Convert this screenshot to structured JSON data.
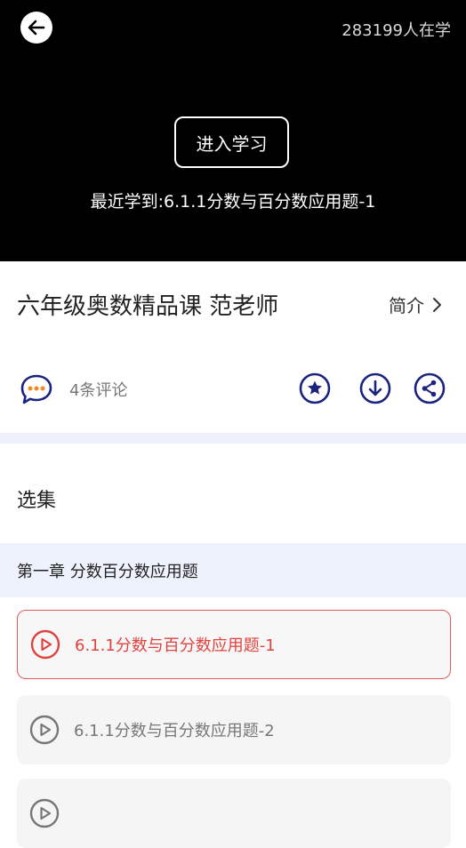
{
  "video": {
    "learner_count": "283199人在学",
    "enter_label": "进入学习",
    "recent_text": "最近学到:6.1.1分数与百分数应用题-1"
  },
  "course": {
    "title": "六年级奥数精品课 范老师",
    "intro_label": "简介"
  },
  "actions": {
    "comment_count": "4条评论",
    "icons": [
      "comment-icon",
      "favorite-icon",
      "download-icon",
      "share-icon"
    ],
    "accent_color": "#1a237e"
  },
  "episodes": {
    "section_title": "选集",
    "chapter_title": "第一章 分数百分数应用题",
    "items": [
      {
        "label": "6.1.1分数与百分数应用题-1",
        "active": true
      },
      {
        "label": "6.1.1分数与百分数应用题-2",
        "active": false
      },
      {
        "label": "",
        "active": false
      }
    ]
  },
  "colors": {
    "active_red": "#e0433f",
    "band_blue": "#eef2fc"
  }
}
